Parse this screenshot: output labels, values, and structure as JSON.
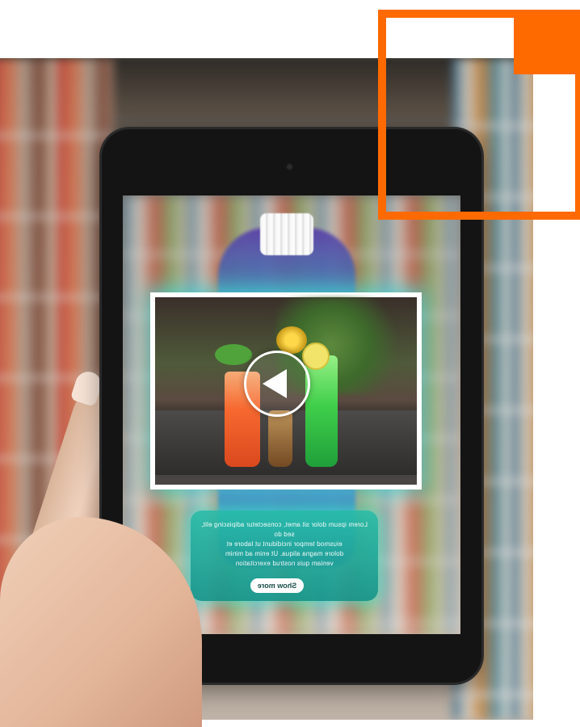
{
  "scene": {
    "description_alt": "",
    "accent_orange": "#ff6a00",
    "ar_glow_color": "#42d6d6"
  },
  "video_card": {
    "play_icon": "play-icon"
  },
  "info_card": {
    "text": "Lorem ipsum dolor sit amet, consectetur adipiscing elit, sed do\neiusmod tempor incididunt ut labore et\ndolore magna aliqua. Ut enim ad minim\nveniam quis nostrud exercitation",
    "button_label": "Show more"
  }
}
